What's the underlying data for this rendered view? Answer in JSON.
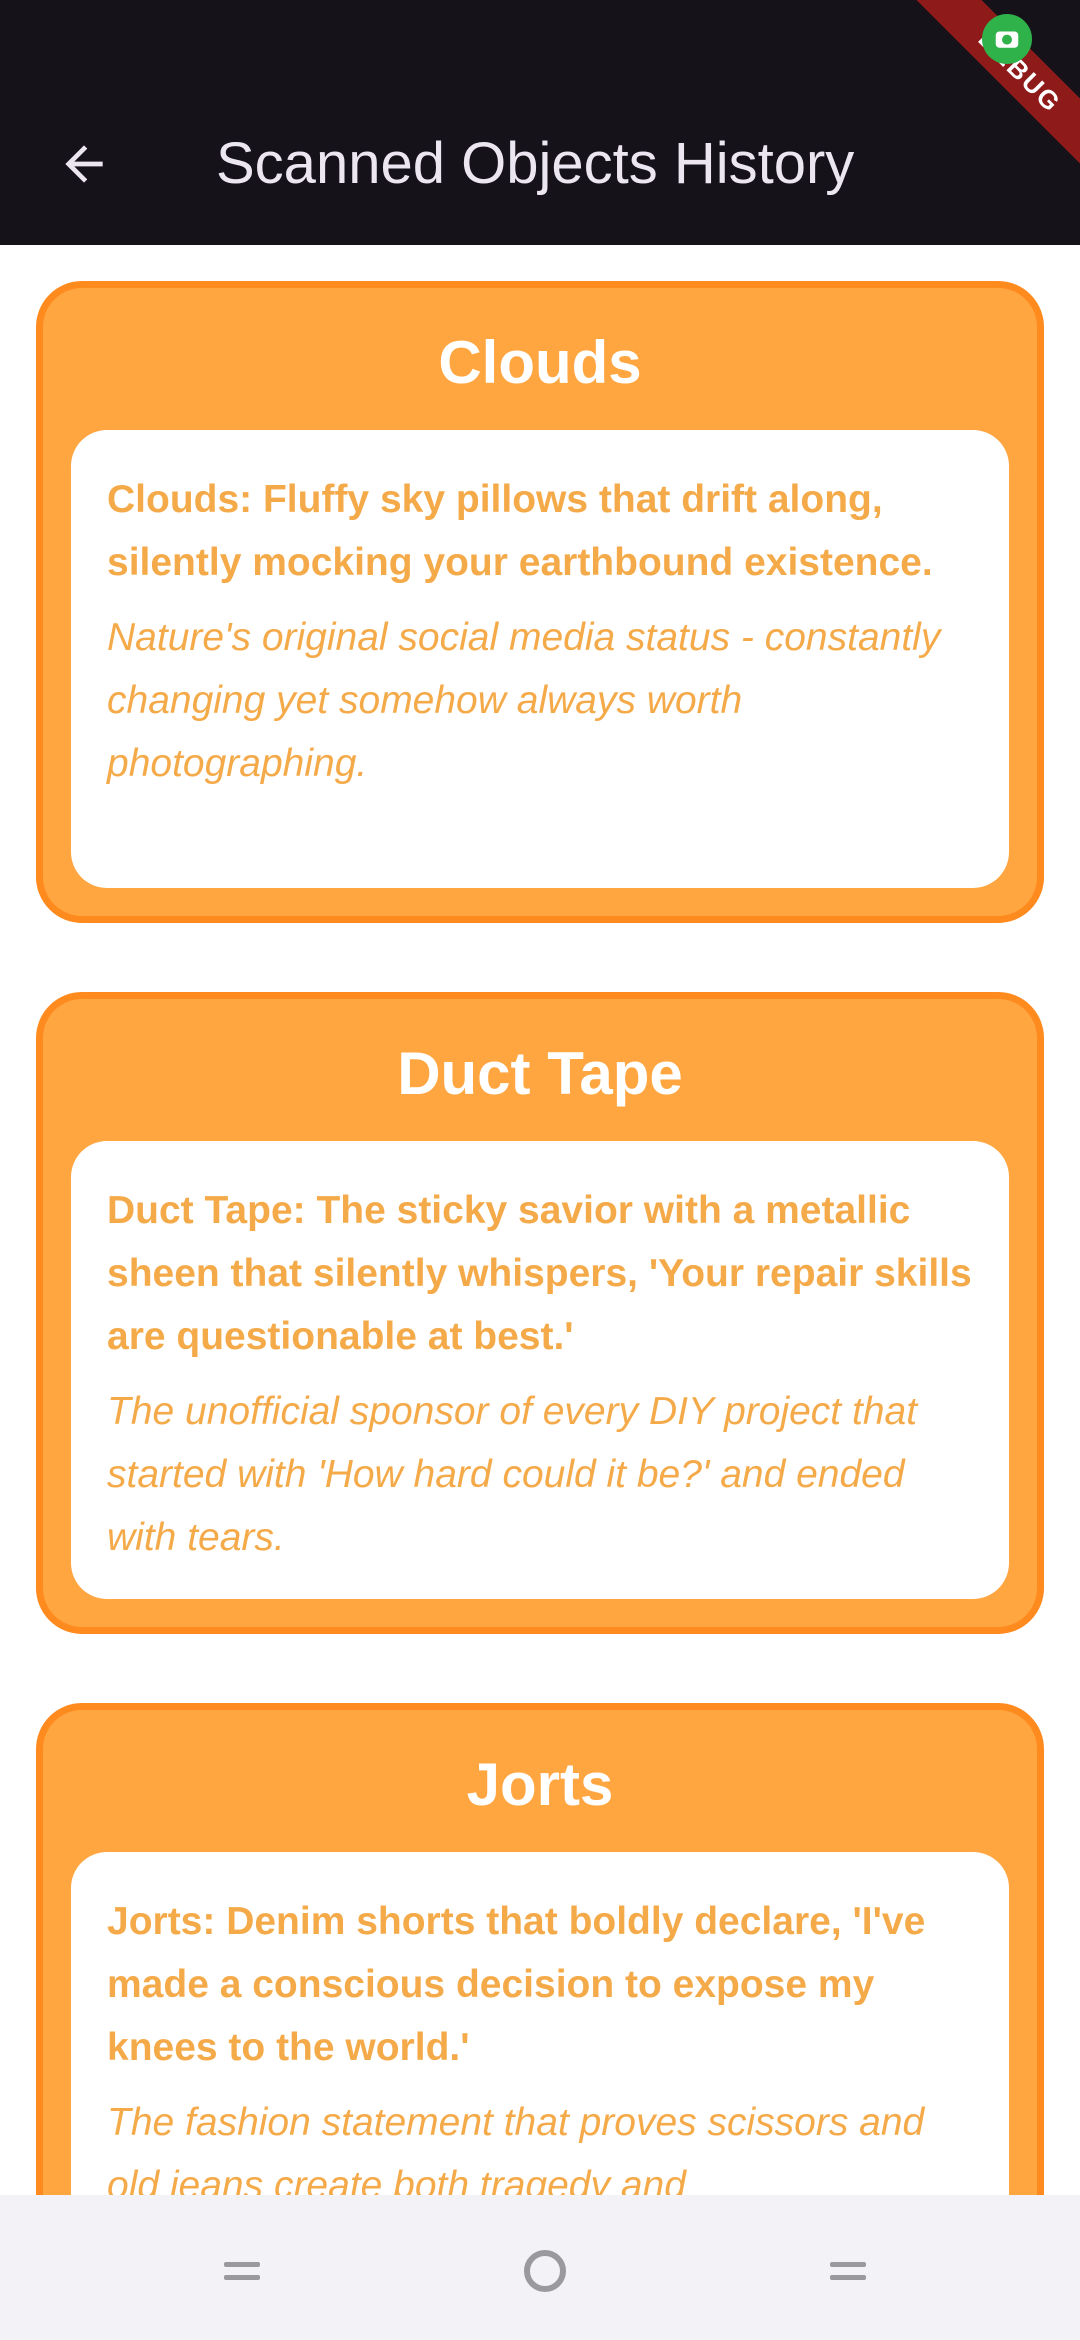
{
  "appbar": {
    "title": "Scanned Objects History",
    "debug_label": "DEBUG"
  },
  "cards": [
    {
      "title": "Clouds",
      "description": "Clouds: Fluffy sky pillows that drift along, silently mocking your earthbound existence.",
      "joke": "Nature's original social media status - constantly changing yet somehow always worth photographing."
    },
    {
      "title": "Duct Tape",
      "description": "Duct Tape: The sticky savior with a metallic sheen that silently whispers, 'Your repair skills are questionable at best.'",
      "joke": "The unofficial sponsor of every DIY project that started with 'How hard could it be?' and ended with tears."
    },
    {
      "title": "Jorts",
      "description": "Jorts: Denim shorts that boldly declare, 'I've made a conscious decision to expose my knees to the world.'",
      "joke": "The fashion statement that proves scissors and old jeans create both tragedy and"
    }
  ],
  "colors": {
    "appbar": "#15121a",
    "card": "#ffa641",
    "card_border": "#ff8a1e",
    "text_accent": "#f5aa4a"
  },
  "icons": {
    "back": "arrow-left-icon",
    "recents": "recents-icon",
    "home": "home-icon",
    "back_nav": "back-nav-icon"
  }
}
